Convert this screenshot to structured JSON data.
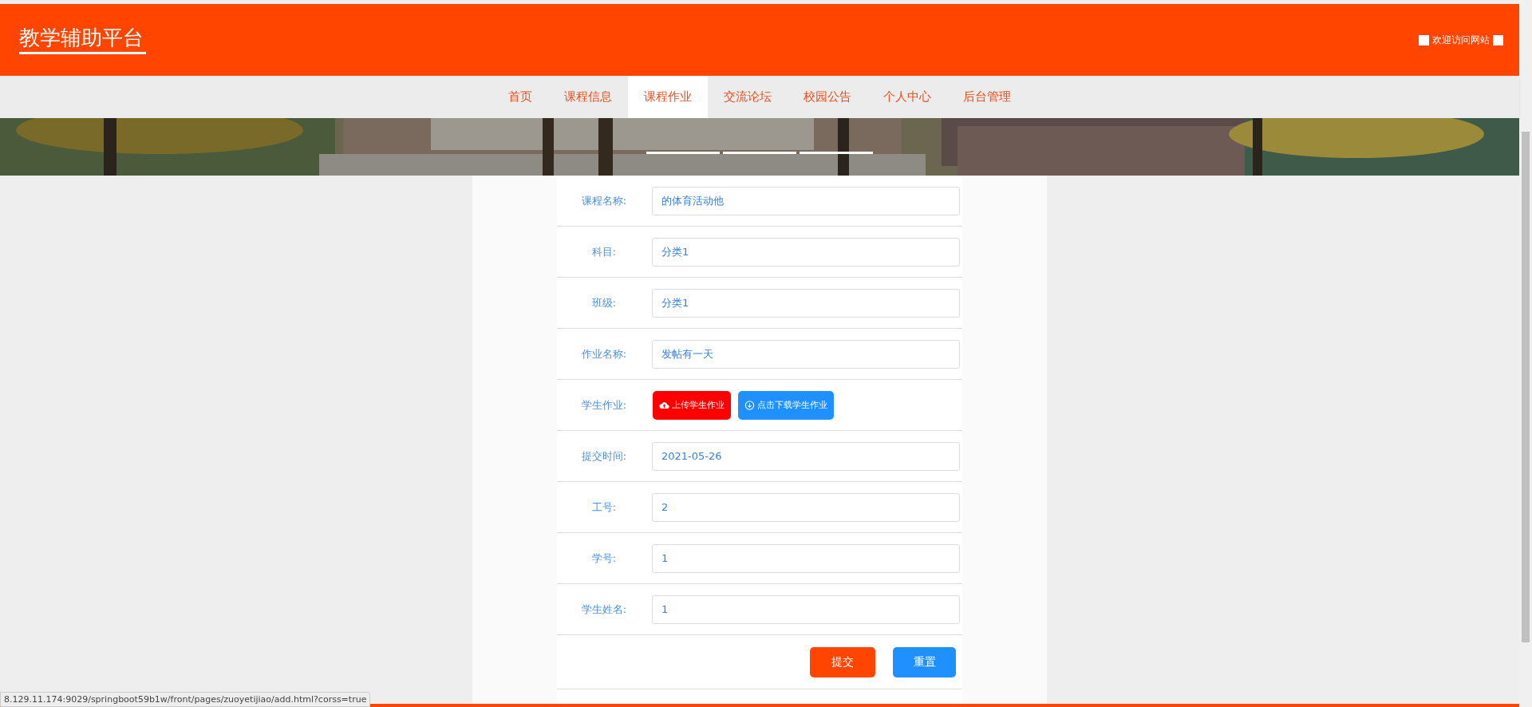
{
  "header": {
    "title": "教学辅助平台",
    "welcome": "欢迎访问网站"
  },
  "nav": [
    {
      "label": "首页",
      "selected": false
    },
    {
      "label": "课程信息",
      "selected": false
    },
    {
      "label": "课程作业",
      "selected": true
    },
    {
      "label": "交流论坛",
      "selected": false
    },
    {
      "label": "校园公告",
      "selected": false
    },
    {
      "label": "个人中心",
      "selected": false
    },
    {
      "label": "后台管理",
      "selected": false
    }
  ],
  "banner": {
    "dots": [
      {
        "selected": true
      },
      {
        "selected": true
      },
      {
        "selected": true
      }
    ]
  },
  "form": [
    {
      "kind": "input",
      "label": "课程名称:",
      "value": "的体育活动他"
    },
    {
      "kind": "input",
      "label": "科目:",
      "value": "分类1"
    },
    {
      "kind": "input",
      "label": "班级:",
      "value": "分类1"
    },
    {
      "kind": "input",
      "label": "作业名称:",
      "value": "发帖有一天"
    },
    {
      "kind": "files",
      "label": "学生作业:",
      "upload": "上传学生作业",
      "download": "点击下载学生作业"
    },
    {
      "kind": "input",
      "label": "提交时间:",
      "value": "2021-05-26"
    },
    {
      "kind": "input",
      "label": "工号:",
      "value": "2"
    },
    {
      "kind": "input",
      "label": "学号:",
      "value": "1"
    },
    {
      "kind": "input",
      "label": "学生姓名:",
      "value": "1"
    }
  ],
  "actions": {
    "submit": "提交",
    "reset": "重置"
  },
  "status_bar": "8.129.11.174:9029/springboot59b1w/front/pages/zuoyetijiao/add.html?corss=true"
}
